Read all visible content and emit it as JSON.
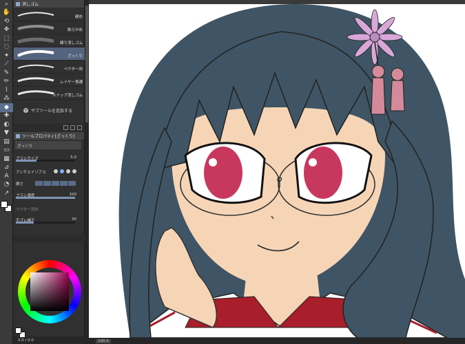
{
  "subtool_panel": {
    "tab_label": "消しゴム",
    "brushes": [
      {
        "label": "硬め",
        "selected": false
      },
      {
        "label": "軟らかめ",
        "selected": false
      },
      {
        "label": "練り消しゴム",
        "selected": false
      },
      {
        "label": "ざっくり",
        "selected": true
      },
      {
        "label": "ベクター用",
        "selected": false
      },
      {
        "label": "レイヤー貫通",
        "selected": false
      },
      {
        "label": "スナップ消しゴム",
        "selected": false
      }
    ],
    "add_subtool_label": "サブツールを追加する"
  },
  "tool_property": {
    "tab_label": "ツールプロパティ[ざっくり]",
    "preview_label": "ざっくり",
    "brush_size": {
      "label": "ブラシサイズ",
      "value": "5.0",
      "fraction": 0.35
    },
    "antialias": {
      "label": "アンチエイリアス",
      "level": 1
    },
    "hardness": {
      "label": "硬さ"
    },
    "brush_density": {
      "label": "ブラシ濃度",
      "value": "100",
      "fraction": 1.0
    },
    "vector_erase": {
      "label": "ベクター消去"
    },
    "stabilization": {
      "label": "手ブレ補正",
      "value": "30",
      "fraction": 0.3
    }
  },
  "status_left": {
    "text": "0.0 / 0.0"
  },
  "status_right": {
    "zoom": "100.0"
  },
  "colors": {
    "main": "#ffffff",
    "sub": "#ffffff",
    "hair": "#3f5565",
    "skin": "#f6d5b6",
    "iris": "#c8385e",
    "ribbon": "#a81e2a",
    "flower": "#d8a7d8",
    "tassel": "#d48a9a"
  }
}
